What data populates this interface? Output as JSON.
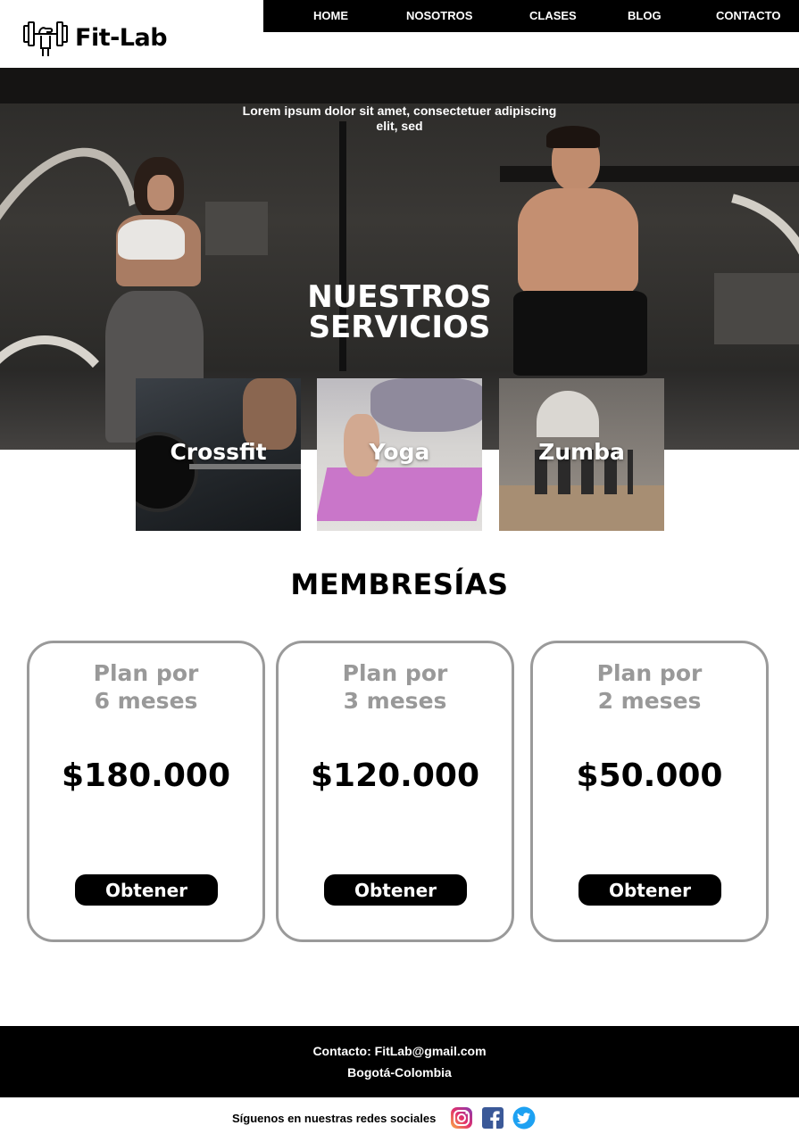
{
  "brand": {
    "name": "Fit-Lab"
  },
  "nav": {
    "items": [
      {
        "label": "HOME"
      },
      {
        "label": "NOSOTROS"
      },
      {
        "label": "CLASES"
      },
      {
        "label": "BLOG"
      },
      {
        "label": "CONTACTO"
      }
    ]
  },
  "hero": {
    "tagline": "Lorem ipsum dolor sit amet, consectetuer adipiscing elit, sed",
    "title": "NUESTROS SERVICIOS"
  },
  "services": [
    {
      "label": "Crossfit"
    },
    {
      "label": "Yoga"
    },
    {
      "label": "Zumba"
    }
  ],
  "memberships": {
    "title": "MEMBRESÍAS",
    "plans": [
      {
        "name": "Plan por\n6 meses",
        "price": "$180.000",
        "button": "Obtener"
      },
      {
        "name": "Plan por\n3 meses",
        "price": "$120.000",
        "button": "Obtener"
      },
      {
        "name": "Plan por\n2 meses",
        "price": "$50.000",
        "button": "Obtener"
      }
    ]
  },
  "footer": {
    "contact": "Contacto: FitLab@gmail.com",
    "location": "Bogotá-Colombia"
  },
  "social": {
    "text": "Síguenos en nuestras redes sociales",
    "icons": [
      "instagram-icon",
      "facebook-icon",
      "twitter-icon"
    ]
  },
  "colors": {
    "nav_bg": "#000000",
    "card_border": "#9a9a9a",
    "plan_name": "#999999",
    "instagram": "#d6249f",
    "facebook": "#3b5998",
    "twitter": "#1da1f2"
  }
}
